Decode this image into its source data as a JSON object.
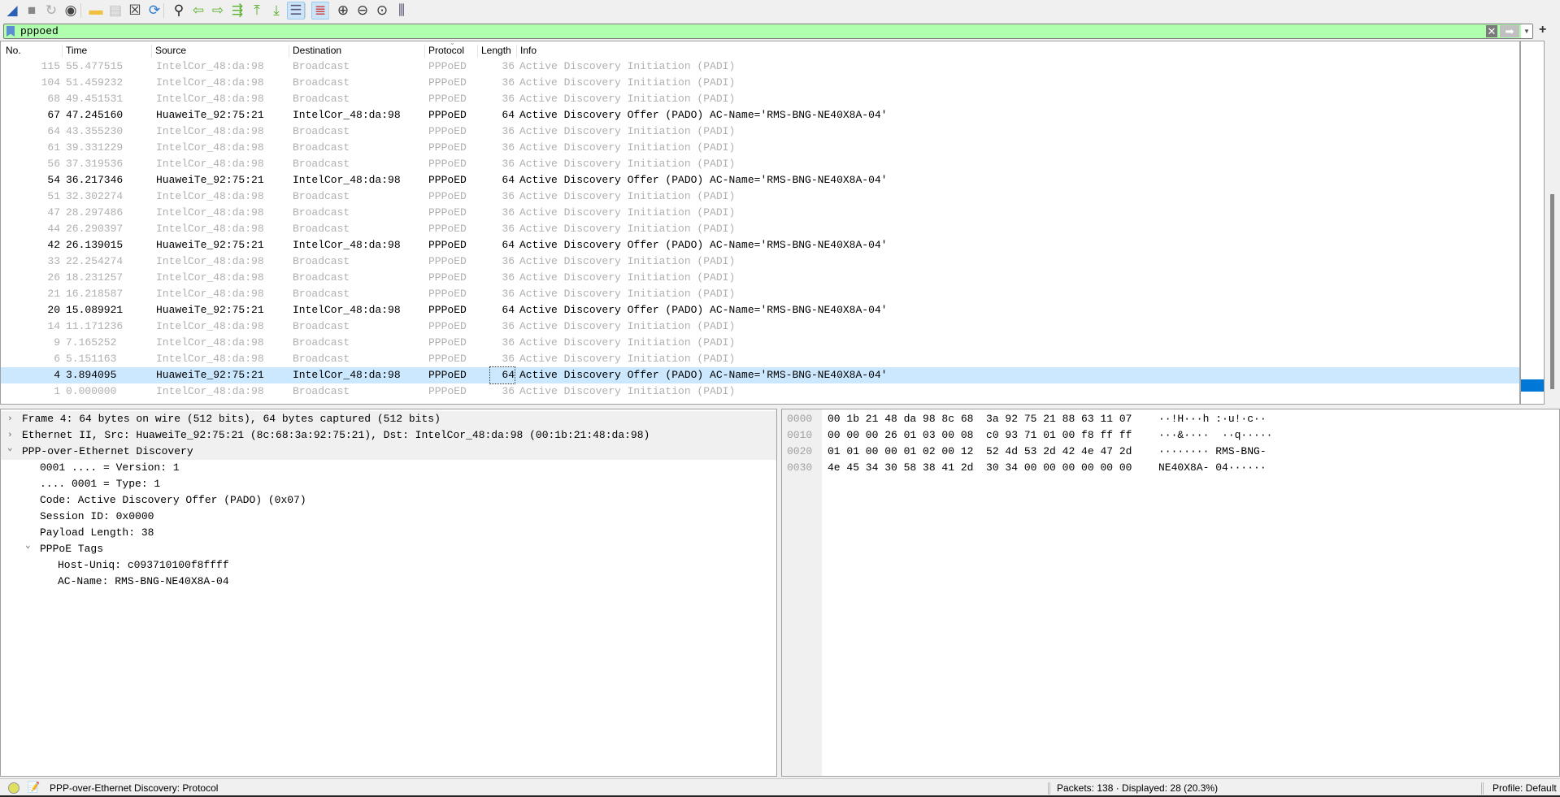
{
  "toolbar": {
    "icons": [
      "shark-fin-start-icon",
      "stop-icon",
      "restart-icon",
      "capture-options-icon",
      "open-folder-icon",
      "save-file-icon",
      "close-file-icon",
      "reload-icon",
      "find-icon",
      "back-arrow-icon",
      "forward-arrow-icon",
      "go-to-packet-icon",
      "first-packet-icon",
      "last-packet-icon",
      "autoscroll-icon",
      "colorize-icon",
      "zoom-in-icon",
      "zoom-out-icon",
      "zoom-normal-icon",
      "resize-columns-icon"
    ]
  },
  "filter": {
    "value": "pppoed",
    "color": "#afffaf"
  },
  "packet_list": {
    "columns": [
      "No.",
      "Time",
      "Source",
      "Destination",
      "Protocol",
      "Length",
      "Info"
    ],
    "rows": [
      {
        "no": "115",
        "time": "55.477515",
        "src": "IntelCor_48:da:98",
        "dst": "Broadcast",
        "proto": "PPPoED",
        "len": "36",
        "info": "Active Discovery Initiation (PADI)",
        "dim": true
      },
      {
        "no": "104",
        "time": "51.459232",
        "src": "IntelCor_48:da:98",
        "dst": "Broadcast",
        "proto": "PPPoED",
        "len": "36",
        "info": "Active Discovery Initiation (PADI)",
        "dim": true
      },
      {
        "no": "68",
        "time": "49.451531",
        "src": "IntelCor_48:da:98",
        "dst": "Broadcast",
        "proto": "PPPoED",
        "len": "36",
        "info": "Active Discovery Initiation (PADI)",
        "dim": true
      },
      {
        "no": "67",
        "time": "47.245160",
        "src": "HuaweiTe_92:75:21",
        "dst": "IntelCor_48:da:98",
        "proto": "PPPoED",
        "len": "64",
        "info": "Active Discovery Offer (PADO) AC-Name='RMS-BNG-NE40X8A-04'",
        "dim": false
      },
      {
        "no": "64",
        "time": "43.355230",
        "src": "IntelCor_48:da:98",
        "dst": "Broadcast",
        "proto": "PPPoED",
        "len": "36",
        "info": "Active Discovery Initiation (PADI)",
        "dim": true
      },
      {
        "no": "61",
        "time": "39.331229",
        "src": "IntelCor_48:da:98",
        "dst": "Broadcast",
        "proto": "PPPoED",
        "len": "36",
        "info": "Active Discovery Initiation (PADI)",
        "dim": true
      },
      {
        "no": "56",
        "time": "37.319536",
        "src": "IntelCor_48:da:98",
        "dst": "Broadcast",
        "proto": "PPPoED",
        "len": "36",
        "info": "Active Discovery Initiation (PADI)",
        "dim": true
      },
      {
        "no": "54",
        "time": "36.217346",
        "src": "HuaweiTe_92:75:21",
        "dst": "IntelCor_48:da:98",
        "proto": "PPPoED",
        "len": "64",
        "info": "Active Discovery Offer (PADO) AC-Name='RMS-BNG-NE40X8A-04'",
        "dim": false
      },
      {
        "no": "51",
        "time": "32.302274",
        "src": "IntelCor_48:da:98",
        "dst": "Broadcast",
        "proto": "PPPoED",
        "len": "36",
        "info": "Active Discovery Initiation (PADI)",
        "dim": true
      },
      {
        "no": "47",
        "time": "28.297486",
        "src": "IntelCor_48:da:98",
        "dst": "Broadcast",
        "proto": "PPPoED",
        "len": "36",
        "info": "Active Discovery Initiation (PADI)",
        "dim": true
      },
      {
        "no": "44",
        "time": "26.290397",
        "src": "IntelCor_48:da:98",
        "dst": "Broadcast",
        "proto": "PPPoED",
        "len": "36",
        "info": "Active Discovery Initiation (PADI)",
        "dim": true
      },
      {
        "no": "42",
        "time": "26.139015",
        "src": "HuaweiTe_92:75:21",
        "dst": "IntelCor_48:da:98",
        "proto": "PPPoED",
        "len": "64",
        "info": "Active Discovery Offer (PADO) AC-Name='RMS-BNG-NE40X8A-04'",
        "dim": false
      },
      {
        "no": "33",
        "time": "22.254274",
        "src": "IntelCor_48:da:98",
        "dst": "Broadcast",
        "proto": "PPPoED",
        "len": "36",
        "info": "Active Discovery Initiation (PADI)",
        "dim": true
      },
      {
        "no": "26",
        "time": "18.231257",
        "src": "IntelCor_48:da:98",
        "dst": "Broadcast",
        "proto": "PPPoED",
        "len": "36",
        "info": "Active Discovery Initiation (PADI)",
        "dim": true
      },
      {
        "no": "21",
        "time": "16.218587",
        "src": "IntelCor_48:da:98",
        "dst": "Broadcast",
        "proto": "PPPoED",
        "len": "36",
        "info": "Active Discovery Initiation (PADI)",
        "dim": true
      },
      {
        "no": "20",
        "time": "15.089921",
        "src": "HuaweiTe_92:75:21",
        "dst": "IntelCor_48:da:98",
        "proto": "PPPoED",
        "len": "64",
        "info": "Active Discovery Offer (PADO) AC-Name='RMS-BNG-NE40X8A-04'",
        "dim": false
      },
      {
        "no": "14",
        "time": "11.171236",
        "src": "IntelCor_48:da:98",
        "dst": "Broadcast",
        "proto": "PPPoED",
        "len": "36",
        "info": "Active Discovery Initiation (PADI)",
        "dim": true
      },
      {
        "no": "9",
        "time": "7.165252",
        "src": "IntelCor_48:da:98",
        "dst": "Broadcast",
        "proto": "PPPoED",
        "len": "36",
        "info": "Active Discovery Initiation (PADI)",
        "dim": true
      },
      {
        "no": "6",
        "time": "5.151163",
        "src": "IntelCor_48:da:98",
        "dst": "Broadcast",
        "proto": "PPPoED",
        "len": "36",
        "info": "Active Discovery Initiation (PADI)",
        "dim": true
      },
      {
        "no": "4",
        "time": "3.894095",
        "src": "HuaweiTe_92:75:21",
        "dst": "IntelCor_48:da:98",
        "proto": "PPPoED",
        "len": "64",
        "info": "Active Discovery Offer (PADO) AC-Name='RMS-BNG-NE40X8A-04'",
        "dim": false,
        "selected": true
      },
      {
        "no": "1",
        "time": "0.000000",
        "src": "IntelCor_48:da:98",
        "dst": "Broadcast",
        "proto": "PPPoED",
        "len": "36",
        "info": "Active Discovery Initiation (PADI)",
        "dim": true
      }
    ],
    "selected_color": "#cce8ff"
  },
  "details": [
    {
      "text": "Frame 4: 64 bytes on wire (512 bits), 64 bytes captured (512 bits)",
      "level": 0,
      "expand": "collapsed"
    },
    {
      "text": "Ethernet II, Src: HuaweiTe_92:75:21 (8c:68:3a:92:75:21), Dst: IntelCor_48:da:98 (00:1b:21:48:da:98)",
      "level": 0,
      "expand": "collapsed"
    },
    {
      "text": "PPP-over-Ethernet Discovery",
      "level": 0,
      "expand": "expanded"
    },
    {
      "text": "0001 .... = Version: 1",
      "level": 1,
      "expand": "none"
    },
    {
      "text": ".... 0001 = Type: 1",
      "level": 1,
      "expand": "none"
    },
    {
      "text": "Code: Active Discovery Offer (PADO) (0x07)",
      "level": 1,
      "expand": "none"
    },
    {
      "text": "Session ID: 0x0000",
      "level": 1,
      "expand": "none"
    },
    {
      "text": "Payload Length: 38",
      "level": 1,
      "expand": "none"
    },
    {
      "text": "PPPoE Tags",
      "level": 1,
      "expand": "expanded"
    },
    {
      "text": "Host-Uniq: c093710100f8ffff",
      "level": 2,
      "expand": "none"
    },
    {
      "text": "AC-Name: RMS-BNG-NE40X8A-04",
      "level": 2,
      "expand": "none"
    }
  ],
  "hex": [
    {
      "offset": "0000",
      "bytes": "00 1b 21 48 da 98 8c 68  3a 92 75 21 88 63 11 07",
      "ascii": "··!H···h :·u!·c··"
    },
    {
      "offset": "0010",
      "bytes": "00 00 00 26 01 03 00 08  c0 93 71 01 00 f8 ff ff",
      "ascii": "···&····  ··q·····"
    },
    {
      "offset": "0020",
      "bytes": "01 01 00 00 01 02 00 12  52 4d 53 2d 42 4e 47 2d",
      "ascii": "········ RMS-BNG-"
    },
    {
      "offset": "0030",
      "bytes": "4e 45 34 30 58 38 41 2d  30 34 00 00 00 00 00 00",
      "ascii": "NE40X8A- 04······"
    }
  ],
  "status": {
    "field_info": "PPP-over-Ethernet Discovery: Protocol",
    "packets": "Packets: 138 · Displayed: 28 (20.3%)",
    "profile": "Profile: Default"
  }
}
